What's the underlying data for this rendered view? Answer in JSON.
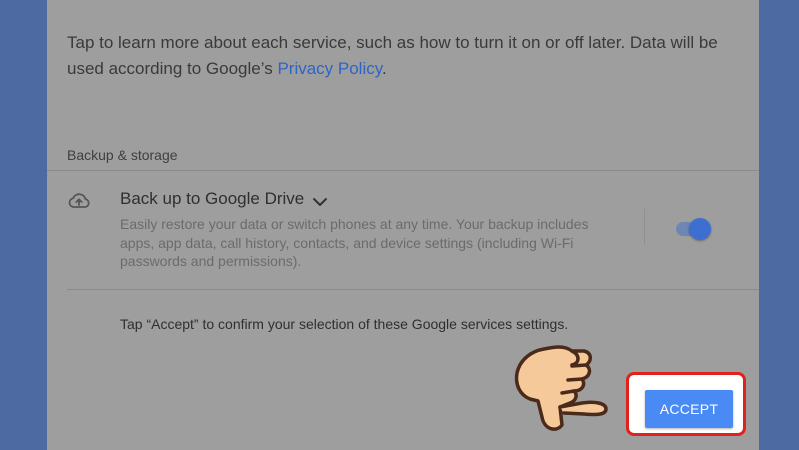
{
  "intro": {
    "text": "Tap to learn more about each service, such as how to turn it on or off later. Data will be used according to Google’s ",
    "link": "Privacy Policy",
    "suffix": "."
  },
  "section": {
    "label": "Backup & storage"
  },
  "backup": {
    "icon": "cloud-upload-icon",
    "title": "Back up to Google Drive",
    "expand_icon": "chevron-down-icon",
    "description": "Easily restore your data or switch phones at any time. Your backup includes apps, app data, call history, contacts, and device settings (including Wi-Fi passwords and permissions).",
    "toggle_on": true
  },
  "footer": {
    "confirm_text": "Tap “Accept” to confirm your selection of these Google services settings.",
    "accept_label": "ACCEPT"
  },
  "overlay": {
    "pointer_icon": "pointing-hand-icon",
    "highlight_color": "#e1211b"
  },
  "colors": {
    "background": "#4d6aa3",
    "card": "#9e9e9e",
    "link": "#2d64c8",
    "toggle": "#3c6fd1",
    "button": "#4a8af4"
  }
}
